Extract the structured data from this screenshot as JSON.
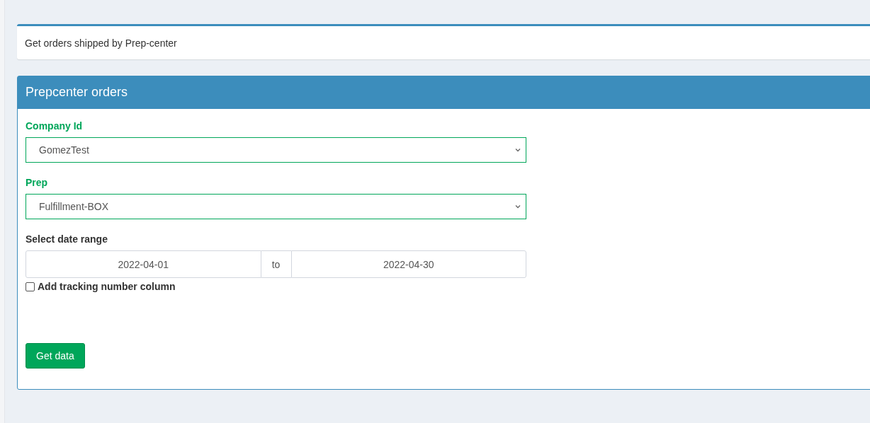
{
  "callout": {
    "text": "Get orders shipped by Prep-center"
  },
  "panel": {
    "title": "Prepcenter orders",
    "selects": [
      {
        "label": "Company Id",
        "value": "GomezTest",
        "valid": true
      },
      {
        "label": "Prep",
        "value": "Fulfillment-BOX",
        "valid": true
      }
    ],
    "date_range": {
      "label": "Select date range",
      "from": "2022-04-01",
      "separator": "to",
      "to": "2022-04-30"
    },
    "tracking_checkbox": {
      "label": "Add tracking number column",
      "checked": false
    },
    "button": "Get data"
  }
}
